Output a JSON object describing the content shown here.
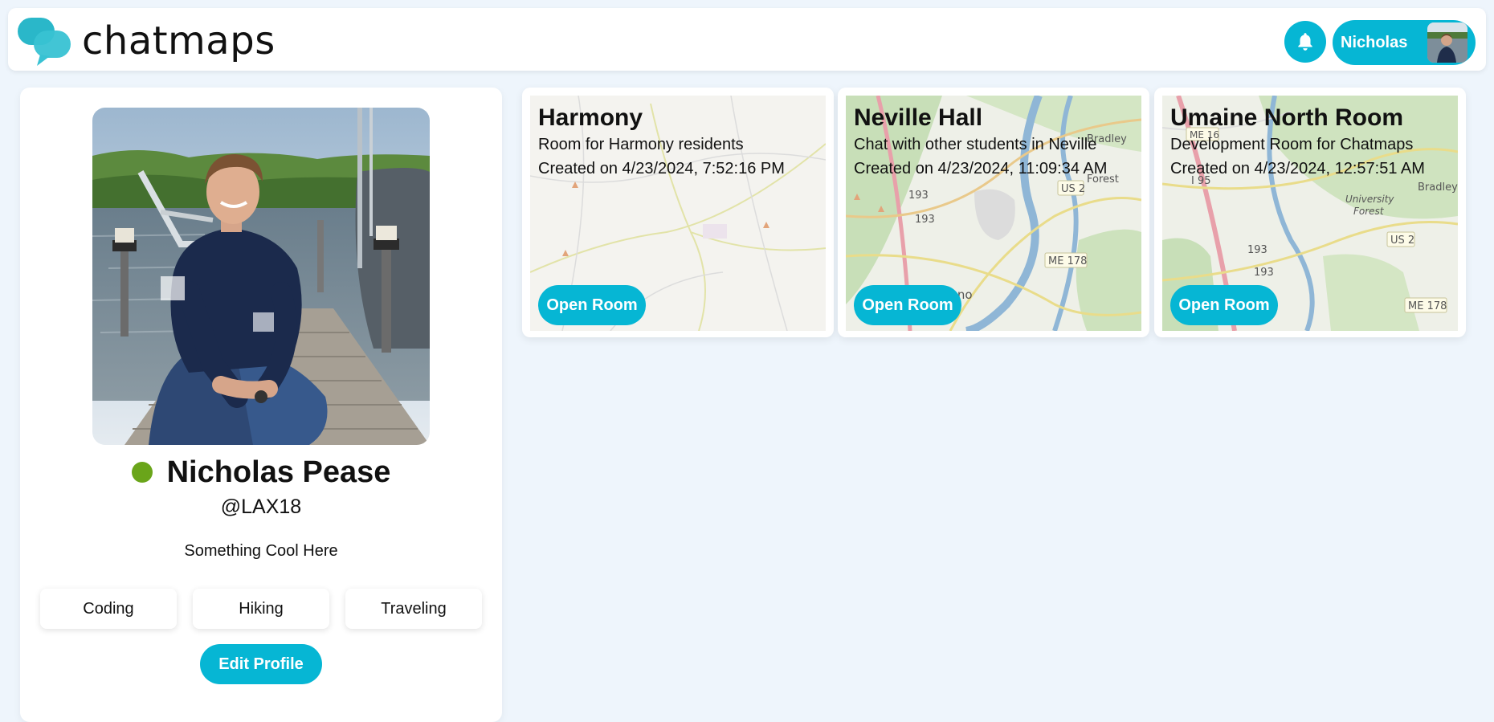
{
  "app": {
    "name": "chatmaps",
    "colors": {
      "accent": "#06b6d4",
      "background": "#eef5fc",
      "online": "#6aa51a"
    }
  },
  "header": {
    "logo_text": "chatmaps",
    "notification_icon": "bell-icon",
    "user_pill": {
      "name": "Nicholas",
      "avatar_icon": "avatar"
    }
  },
  "profile": {
    "name": "Nicholas Pease",
    "handle": "@LAX18",
    "bio": "Something Cool Here",
    "status": "online",
    "interests": [
      "Coding",
      "Hiking",
      "Traveling"
    ],
    "edit_label": "Edit Profile"
  },
  "rooms": [
    {
      "title": "Harmony",
      "description": "Room for Harmony residents",
      "created": "Created on 4/23/2024, 7:52:16 PM",
      "button_label": "Open Room",
      "map_labels": []
    },
    {
      "title": "Neville Hall",
      "description": "Chat with other students in Neville",
      "created": "Created on 4/23/2024, 11:09:34 AM",
      "button_label": "Open Room",
      "map_labels": [
        "Bradley",
        "Forest",
        "US 2",
        "193",
        "193",
        "ME 178",
        "Orono"
      ]
    },
    {
      "title": "Umaine North Room",
      "description": "Development Room for Chatmaps",
      "created": "Created on 4/23/2024, 12:57:51 AM",
      "button_label": "Open Room",
      "map_labels": [
        "ME 16",
        "I 95",
        "Bradley",
        "University",
        "Forest",
        "US 2",
        "193",
        "193",
        "ME 178"
      ]
    }
  ]
}
